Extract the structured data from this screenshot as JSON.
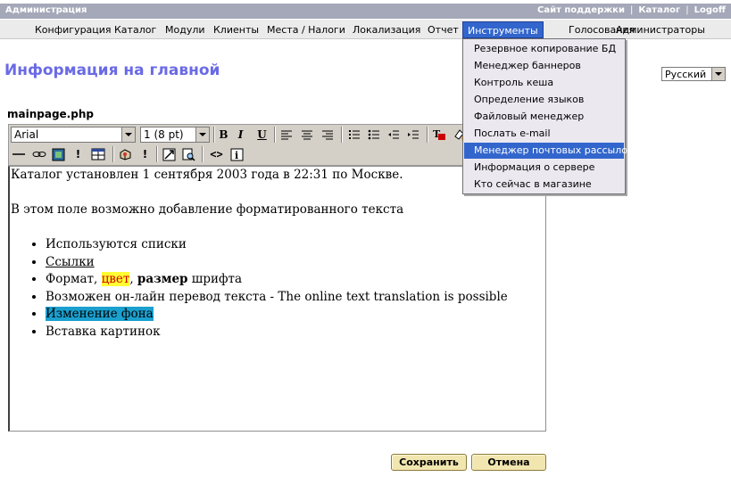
{
  "topbar": {
    "title": "Администрация",
    "links": [
      "Сайт поддержки",
      "Каталог",
      "Logoff"
    ]
  },
  "menu": {
    "items": [
      "Конфигурация",
      "Каталог",
      "Модули",
      "Клиенты",
      "Места / Налоги",
      "Локализация",
      "Отчет",
      "Инструменты",
      "Голосования",
      "Администраторы"
    ],
    "active": "Инструменты"
  },
  "dropdown": {
    "items": [
      "Резервное копирование БД",
      "Менеджер баннеров",
      "Контроль кеша",
      "Определение языков",
      "Файловый менеджер",
      "Послать e-mail",
      "Менеджер почтовых рассылок",
      "Информация о сервере",
      "Кто сейчас в магазине"
    ],
    "highlighted": "Менеджер почтовых рассылок"
  },
  "page": {
    "title": "Информация на главной",
    "language": "Русский",
    "file_label": "mainpage.php"
  },
  "toolbar": {
    "font": "Arial",
    "size": "1 (8 pt)",
    "bold_label": "B",
    "italic_label": "I",
    "underline_label": "U",
    "icons": [
      "bold-icon",
      "italic-icon",
      "underline-icon",
      "align-left-icon",
      "align-center-icon",
      "align-right-icon",
      "ordered-list-icon",
      "unordered-list-icon",
      "outdent-icon",
      "indent-icon",
      "text-color-icon",
      "bg-color-icon",
      "horizontal-rule-icon",
      "link-icon",
      "image-icon",
      "special-char-icon",
      "table-icon",
      "form-icon",
      "anchor-icon",
      "fullscreen-icon",
      "preview-icon",
      "source-code-icon",
      "info-icon"
    ]
  },
  "editor": {
    "line1": "Каталог установлен 1 сентября 2003 года в 22:31 по Москве.",
    "line2": "В этом поле возможно добавление форматированного текста",
    "list": {
      "item1": "Используются списки",
      "item2": "Ссылки",
      "item3_prefix": "Формат, ",
      "item3_color": "цвет",
      "item3_comma": ", ",
      "item3_bold": "размер",
      "item3_suffix": " шрифта",
      "item4": "Возможен он-лайн перевод текста - The online text translation is possible",
      "item5": "Изменение фона",
      "item6": "Вставка картинок"
    }
  },
  "buttons": {
    "save": "Сохранить",
    "cancel": "Отмена"
  },
  "colors": {
    "title": "#6a6ae6",
    "menu_active": "#3366cc",
    "highlight_yellow": "#ffff33",
    "highlight_blue": "#1aa0cf",
    "button_bg": "#f2e6b0"
  }
}
